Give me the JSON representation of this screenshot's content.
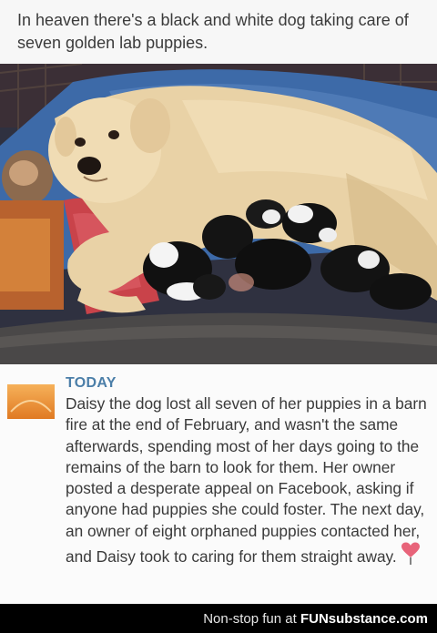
{
  "post": {
    "caption": "In heaven there's a black and white dog taking care of seven golden lab puppies."
  },
  "article": {
    "source": "TODAY",
    "logo_text": "Today",
    "text": "Daisy the dog lost all seven of her puppies in a barn fire at the end of February, and wasn't the same afterwards, spending most of her days going to the remains of the barn to look for them. Her owner posted a desperate appeal on Facebook, asking if anyone had puppies she could foster. The next day, an owner of eight orphaned puppies contacted her, and Daisy took to caring for them straight away."
  },
  "footer": {
    "tagline": "Non-stop fun at",
    "brand": "FUNsubstance.com"
  },
  "icons": {
    "logo": "today-logo-icon",
    "heart": "heart-icon"
  },
  "colors": {
    "source_blue": "#4b7ea8",
    "logo_orange": "#e98a2b",
    "heart_pink": "#e8647a"
  }
}
